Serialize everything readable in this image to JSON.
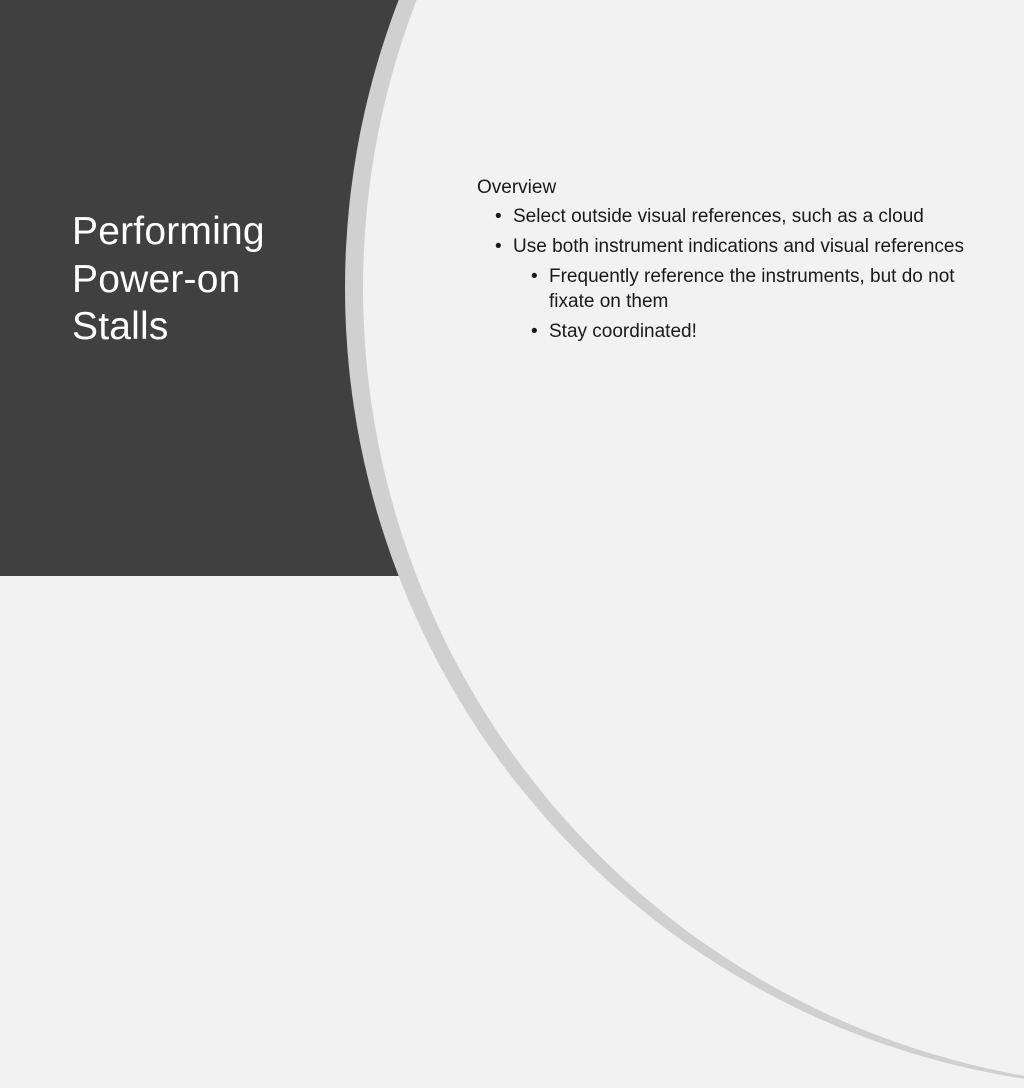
{
  "slide": {
    "title_line1": "Performing",
    "title_line2": "Power-on",
    "title_line3": "Stalls",
    "overview_heading": "Overview",
    "bullets": {
      "b1": "Select outside visual references, such as a cloud",
      "b2": "Use both instrument indications and visual references",
      "b2_sub1": "Frequently reference the instruments, but do not fixate on them",
      "b2_sub2": "Stay coordinated!"
    }
  },
  "colors": {
    "dark_bg": "#404040",
    "light_bg": "#f2f2f2",
    "curve_accent": "#d0d0d0",
    "title_text": "#ffffff",
    "body_text": "#1a1a1a"
  }
}
